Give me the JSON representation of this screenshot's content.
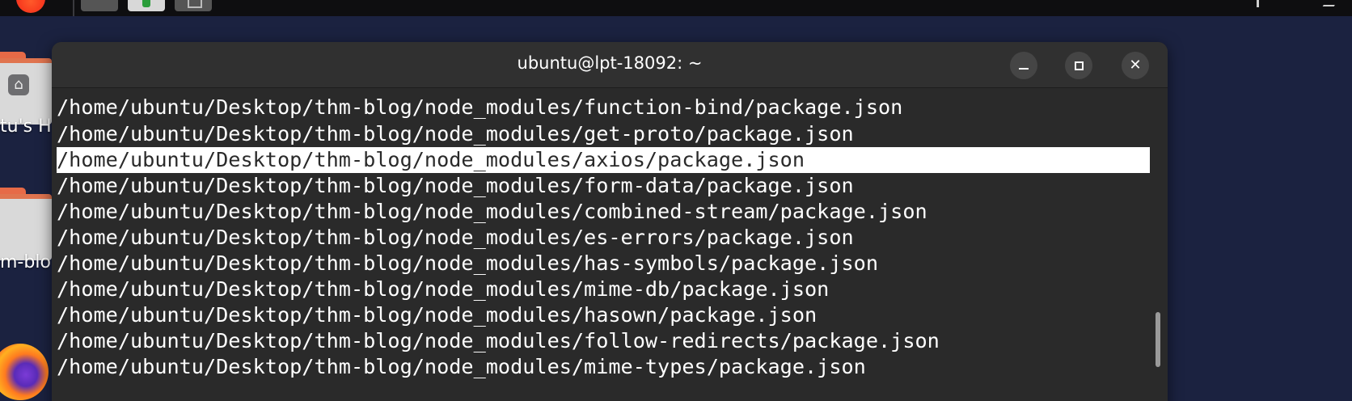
{
  "terminal": {
    "title": "ubuntu@lpt-18092: ~",
    "buttons": {
      "minimize": "minimize",
      "maximize": "maximize",
      "close": "✕"
    },
    "lines": [
      "/home/ubuntu/Desktop/thm-blog/node_modules/function-bind/package.json",
      "/home/ubuntu/Desktop/thm-blog/node_modules/get-proto/package.json",
      "/home/ubuntu/Desktop/thm-blog/node_modules/axios/package.json",
      "/home/ubuntu/Desktop/thm-blog/node_modules/form-data/package.json",
      "/home/ubuntu/Desktop/thm-blog/node_modules/combined-stream/package.json",
      "/home/ubuntu/Desktop/thm-blog/node_modules/es-errors/package.json",
      "/home/ubuntu/Desktop/thm-blog/node_modules/has-symbols/package.json",
      "/home/ubuntu/Desktop/thm-blog/node_modules/mime-db/package.json",
      "/home/ubuntu/Desktop/thm-blog/node_modules/hasown/package.json",
      "/home/ubuntu/Desktop/thm-blog/node_modules/follow-redirects/package.json",
      "/home/ubuntu/Desktop/thm-blog/node_modules/mime-types/package.json"
    ],
    "selected_line_index": 2
  },
  "desktop": {
    "home_folder_label": "tu's H",
    "blog_folder_label": "m-blo",
    "icons": [
      "home-folder-icon",
      "folder-icon",
      "firefox-icon"
    ]
  },
  "colors": {
    "desktop_bg": "#1b2240",
    "terminal_bg": "#2a2a2a",
    "titlebar_bg": "#303030",
    "selection_bg": "#ffffff",
    "folder_accent": "#e66a47"
  }
}
